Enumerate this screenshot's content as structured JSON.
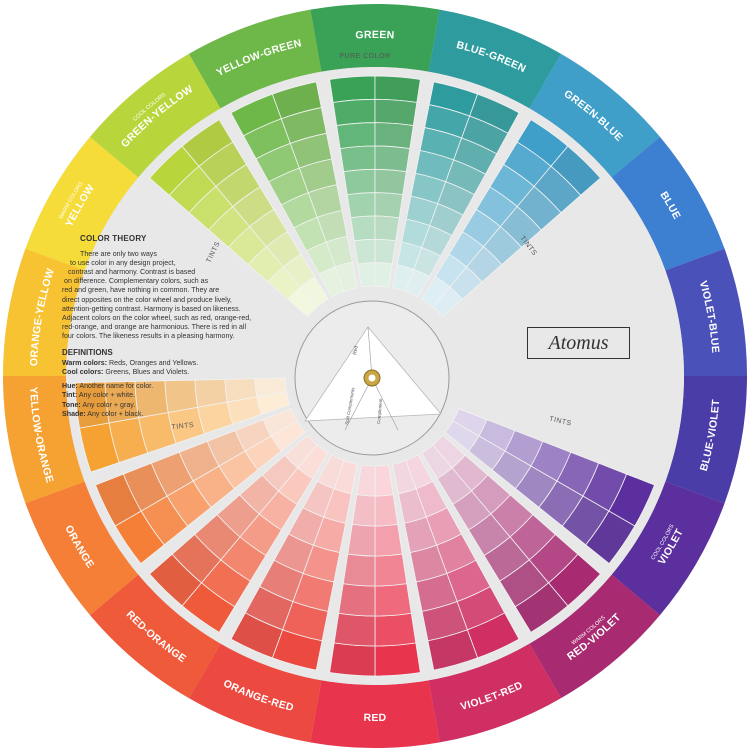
{
  "ring": [
    {
      "name": "GREEN",
      "color": "#3aa256"
    },
    {
      "name": "BLUE-GREEN",
      "color": "#2e9c9e"
    },
    {
      "name": "GREEN-BLUE",
      "color": "#3f9fc9"
    },
    {
      "name": "BLUE",
      "color": "#3d7fd0"
    },
    {
      "name": "VIOLET-BLUE",
      "color": "#4a52b9"
    },
    {
      "name": "BLUE-VIOLET",
      "color": "#4a3da8"
    },
    {
      "name": "VIOLET",
      "color": "#5c2f9e",
      "sub": "COOL COLORS"
    },
    {
      "name": "RED-VIOLET",
      "color": "#a82b72",
      "sub": "WARM COLORS"
    },
    {
      "name": "VIOLET-RED",
      "color": "#cf2f63"
    },
    {
      "name": "RED",
      "color": "#e8344d"
    },
    {
      "name": "ORANGE-RED",
      "color": "#ec4a40"
    },
    {
      "name": "RED-ORANGE",
      "color": "#ef5a3a"
    },
    {
      "name": "ORANGE",
      "color": "#f57f37"
    },
    {
      "name": "YELLOW-ORANGE",
      "color": "#f6a233"
    },
    {
      "name": "ORANGE-YELLOW",
      "color": "#f8c332"
    },
    {
      "name": "YELLOW",
      "color": "#f6dc38",
      "sub": "WARM COLORS"
    },
    {
      "name": "GREEN-YELLOW",
      "color": "#b8d63c",
      "sub": "COOL COLORS"
    },
    {
      "name": "YELLOW-GREEN",
      "color": "#6db848"
    }
  ],
  "pure_color_label": "PURE COLOR",
  "tints_label": "TINTS",
  "brand": "Atomus",
  "theory": {
    "title": "COLOR THEORY",
    "para_lines": [
      "There are only two ways",
      "to use color in any design project,",
      "contrast and harmony.  Contrast is based",
      "on difference.  Complementary colors, such as",
      "red and green, have nothing in common.  They are",
      "direct opposites on the color wheel and produce lively,",
      "attention-getting contrast.  Harmony is based on likeness.",
      "Adjacent colors on the color wheel, such as red, orange-red,",
      "red-orange, and orange are harmonious.  There is red in all",
      "four colors.  The likeness results in a pleasing harmony."
    ],
    "defs_title": "DEFINITIONS",
    "defs": [
      {
        "term": "Warm colors:",
        "text": "Reds, Oranges and Yellows."
      },
      {
        "term": "Cool colors:",
        "text": "Greens, Blues and Violets."
      }
    ],
    "defs2": [
      {
        "term": "Hue:",
        "text": "Another name for color."
      },
      {
        "term": "Tint:",
        "text": "Any color + white."
      },
      {
        "term": "Tone:",
        "text": "Any color + gray."
      },
      {
        "term": "Shade:",
        "text": "Any color + black."
      }
    ]
  },
  "center_labels": [
    "Red",
    "Split Complements",
    "Complement"
  ],
  "colors": {
    "disc": "#e9e8e8",
    "board": "#ffffff",
    "text": "#333333"
  }
}
